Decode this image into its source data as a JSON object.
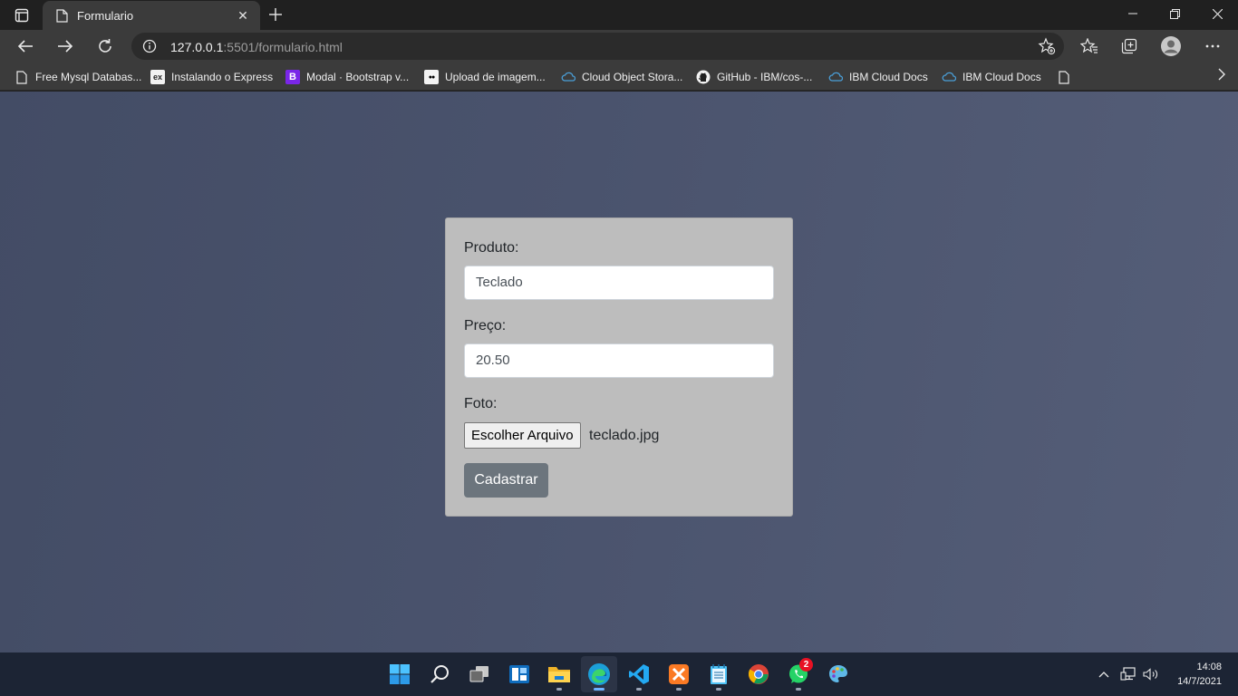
{
  "browser": {
    "tab_title": "Formulario",
    "url_host": "127.0.0.1",
    "url_rest": ":5501/formulario.html"
  },
  "favorites": [
    {
      "label": "Free Mysql Databas...",
      "icon": "document-icon"
    },
    {
      "label": "Instalando o Express",
      "icon": "express-icon",
      "icon_text": "ex"
    },
    {
      "label": "Modal · Bootstrap v...",
      "icon": "bootstrap-icon",
      "icon_text": "B"
    },
    {
      "label": "Upload de imagem...",
      "icon": "medium-icon",
      "icon_text": "●●"
    },
    {
      "label": "Cloud Object Stora...",
      "icon": "ibm-cloud-icon"
    },
    {
      "label": "GitHub - IBM/cos-...",
      "icon": "github-icon"
    },
    {
      "label": "IBM Cloud Docs",
      "icon": "ibm-cloud-icon"
    },
    {
      "label": "IBM Cloud Docs",
      "icon": "ibm-cloud-icon"
    },
    {
      "label": "",
      "icon": "document-icon"
    }
  ],
  "form": {
    "produto_label": "Produto:",
    "produto_value": "Teclado",
    "preco_label": "Preço:",
    "preco_value": "20.50",
    "foto_label": "Foto:",
    "file_button": "Escolher Arquivo",
    "file_name": "teclado.jpg",
    "submit_label": "Cadastrar"
  },
  "taskbar": {
    "apps": [
      "start-icon",
      "search-icon",
      "task-view-icon",
      "widgets-icon",
      "file-explorer-icon",
      "edge-icon",
      "vscode-icon",
      "xampp-icon",
      "notepad-icon",
      "chrome-icon",
      "whatsapp-icon",
      "paint-icon"
    ],
    "whatsapp_badge": "2",
    "time": "14:08",
    "date": "14/7/2021"
  },
  "colors": {
    "card_bg": "#bdbdbd",
    "submit_bg": "#6c757d",
    "page_bg": "#4a536d",
    "taskbar_bg": "#1c2434"
  }
}
